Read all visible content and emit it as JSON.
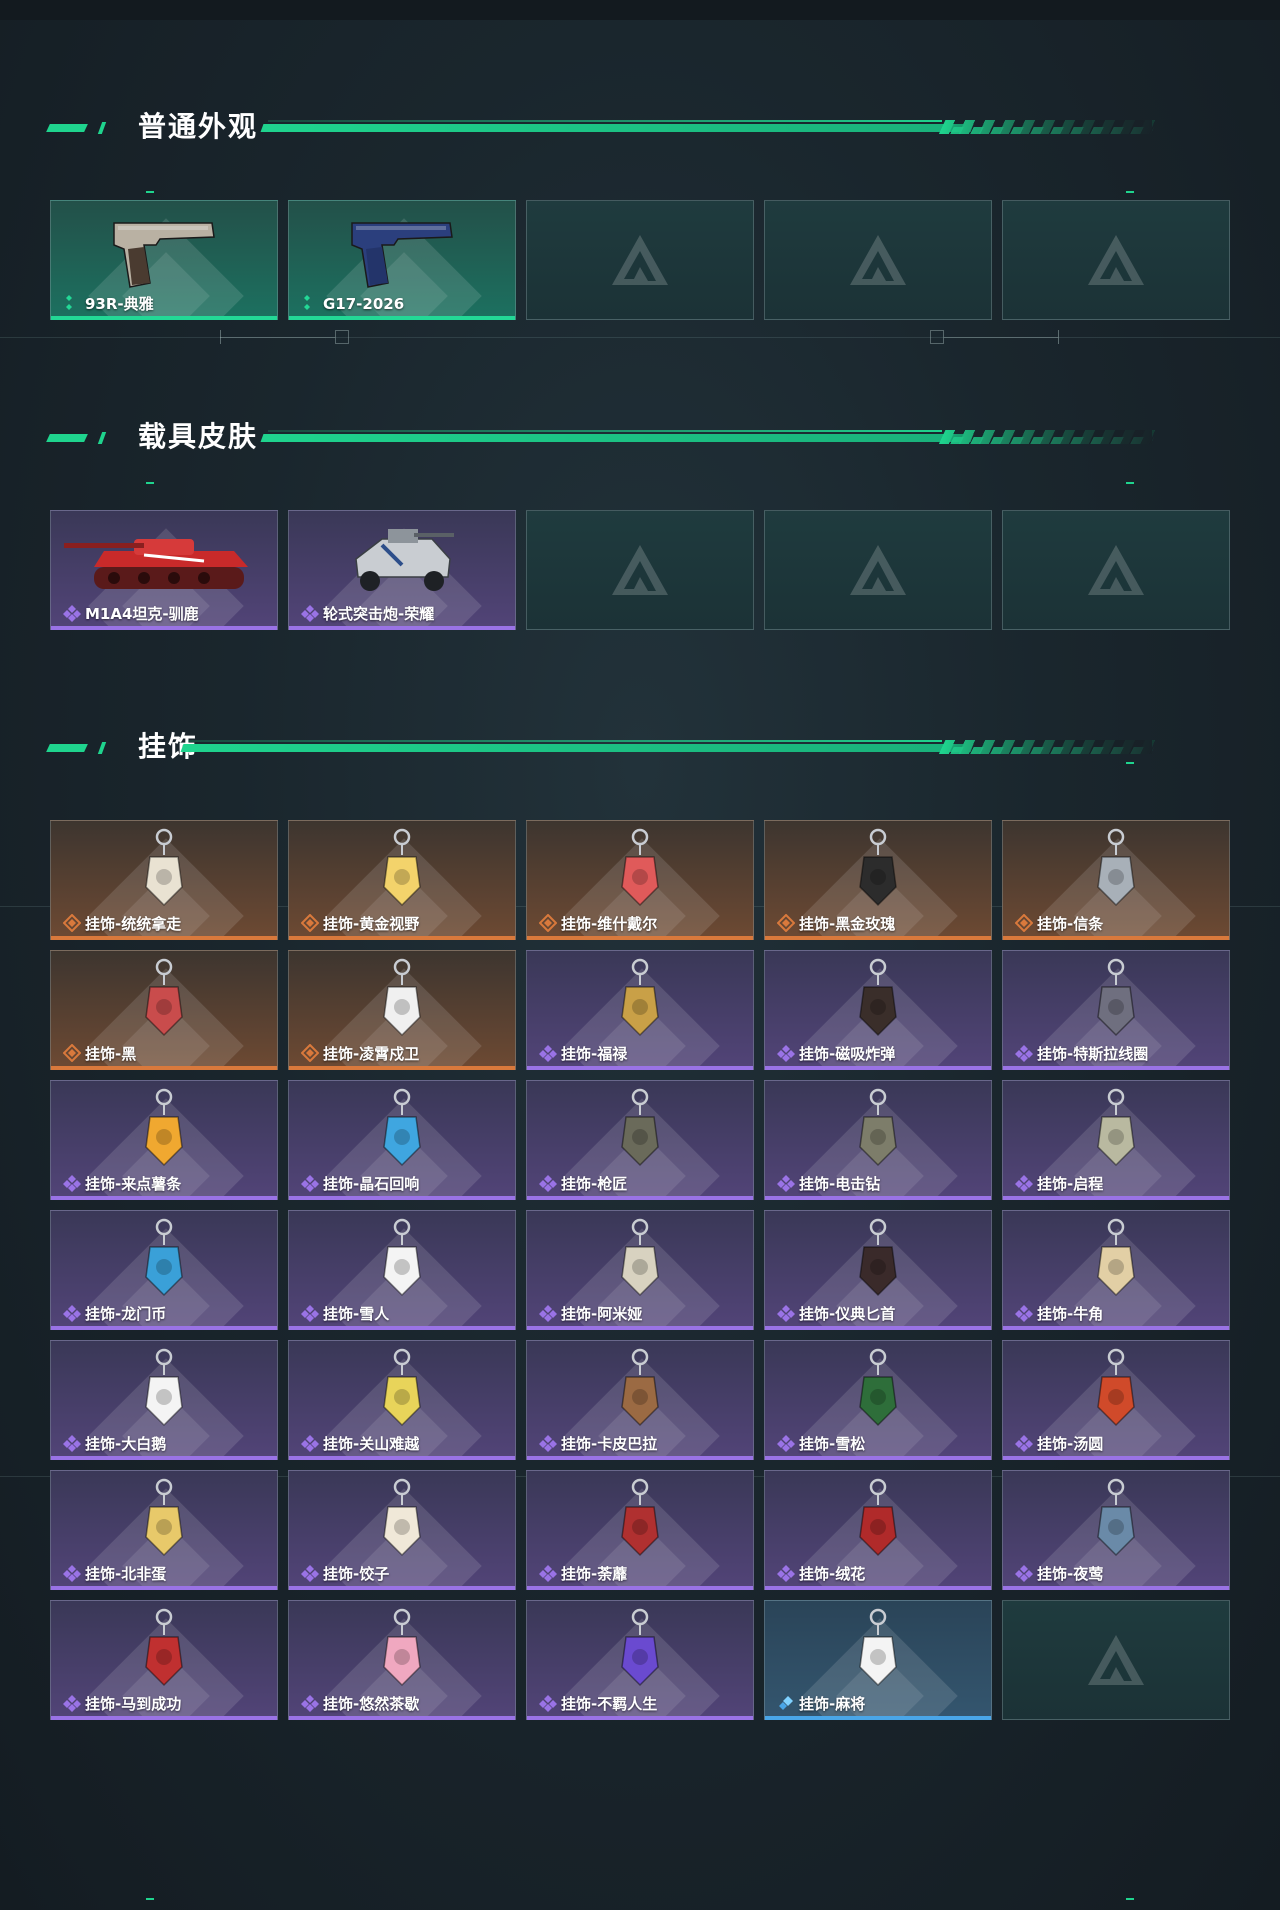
{
  "sections": [
    {
      "title": "普通外观",
      "items": [
        {
          "label": "93R-典雅",
          "rarity": "green",
          "icon": "pistol-icon"
        },
        {
          "label": "G17-2026",
          "rarity": "green",
          "icon": "pistol-icon"
        },
        {
          "label": "",
          "rarity": "empty"
        },
        {
          "label": "",
          "rarity": "empty"
        },
        {
          "label": "",
          "rarity": "empty"
        }
      ]
    },
    {
      "title": "载具皮肤",
      "items": [
        {
          "label": "M1A4坦克-驯鹿",
          "rarity": "purple",
          "icon": "tank-icon"
        },
        {
          "label": "轮式突击炮-荣耀",
          "rarity": "purple",
          "icon": "armored-vehicle-icon"
        },
        {
          "label": "",
          "rarity": "empty"
        },
        {
          "label": "",
          "rarity": "empty"
        },
        {
          "label": "",
          "rarity": "empty"
        }
      ]
    },
    {
      "title": "挂饰",
      "items": [
        {
          "label": "挂饰-统统拿走",
          "rarity": "orange",
          "icon": "charm-icon"
        },
        {
          "label": "挂饰-黄金视野",
          "rarity": "orange",
          "icon": "charm-icon"
        },
        {
          "label": "挂饰-维什戴尔",
          "rarity": "orange",
          "icon": "charm-icon"
        },
        {
          "label": "挂饰-黑金玫瑰",
          "rarity": "orange",
          "icon": "charm-icon"
        },
        {
          "label": "挂饰-信条",
          "rarity": "orange",
          "icon": "charm-icon"
        },
        {
          "label": "挂饰-黑",
          "rarity": "orange",
          "icon": "charm-icon"
        },
        {
          "label": "挂饰-凌霄戍卫",
          "rarity": "orange",
          "icon": "charm-icon"
        },
        {
          "label": "挂饰-福禄",
          "rarity": "purple",
          "icon": "charm-icon"
        },
        {
          "label": "挂饰-磁吸炸弹",
          "rarity": "purple",
          "icon": "charm-icon"
        },
        {
          "label": "挂饰-特斯拉线圈",
          "rarity": "purple",
          "icon": "charm-icon"
        },
        {
          "label": "挂饰-来点薯条",
          "rarity": "purple",
          "icon": "charm-icon"
        },
        {
          "label": "挂饰-晶石回响",
          "rarity": "purple",
          "icon": "charm-icon"
        },
        {
          "label": "挂饰-枪匠",
          "rarity": "purple",
          "icon": "charm-icon"
        },
        {
          "label": "挂饰-电击钻",
          "rarity": "purple",
          "icon": "charm-icon"
        },
        {
          "label": "挂饰-启程",
          "rarity": "purple",
          "icon": "charm-icon"
        },
        {
          "label": "挂饰-龙门币",
          "rarity": "purple",
          "icon": "charm-icon"
        },
        {
          "label": "挂饰-雪人",
          "rarity": "purple",
          "icon": "charm-icon"
        },
        {
          "label": "挂饰-阿米娅",
          "rarity": "purple",
          "icon": "charm-icon"
        },
        {
          "label": "挂饰-仪典匕首",
          "rarity": "purple",
          "icon": "charm-icon"
        },
        {
          "label": "挂饰-牛角",
          "rarity": "purple",
          "icon": "charm-icon"
        },
        {
          "label": "挂饰-大白鹅",
          "rarity": "purple",
          "icon": "charm-icon"
        },
        {
          "label": "挂饰-关山难越",
          "rarity": "purple",
          "icon": "charm-icon"
        },
        {
          "label": "挂饰-卡皮巴拉",
          "rarity": "purple",
          "icon": "charm-icon"
        },
        {
          "label": "挂饰-雪松",
          "rarity": "purple",
          "icon": "charm-icon"
        },
        {
          "label": "挂饰-汤圆",
          "rarity": "purple",
          "icon": "charm-icon"
        },
        {
          "label": "挂饰-北非蛋",
          "rarity": "purple",
          "icon": "charm-icon"
        },
        {
          "label": "挂饰-饺子",
          "rarity": "purple",
          "icon": "charm-icon"
        },
        {
          "label": "挂饰-荼蘼",
          "rarity": "purple",
          "icon": "charm-icon"
        },
        {
          "label": "挂饰-绒花",
          "rarity": "purple",
          "icon": "charm-icon"
        },
        {
          "label": "挂饰-夜莺",
          "rarity": "purple",
          "icon": "charm-icon"
        },
        {
          "label": "挂饰-马到成功",
          "rarity": "purple",
          "icon": "charm-icon"
        },
        {
          "label": "挂饰-悠然茶歇",
          "rarity": "purple",
          "icon": "charm-icon"
        },
        {
          "label": "挂饰-不羁人生",
          "rarity": "purple",
          "icon": "charm-icon"
        },
        {
          "label": "挂饰-麻将",
          "rarity": "blue",
          "icon": "charm-icon"
        },
        {
          "label": "",
          "rarity": "empty"
        }
      ]
    }
  ],
  "colors": {
    "accent": "#1fd48e",
    "green": "#23d896",
    "purple": "#9a73e6",
    "orange": "#d9793c",
    "blue": "#4aa6e8"
  }
}
